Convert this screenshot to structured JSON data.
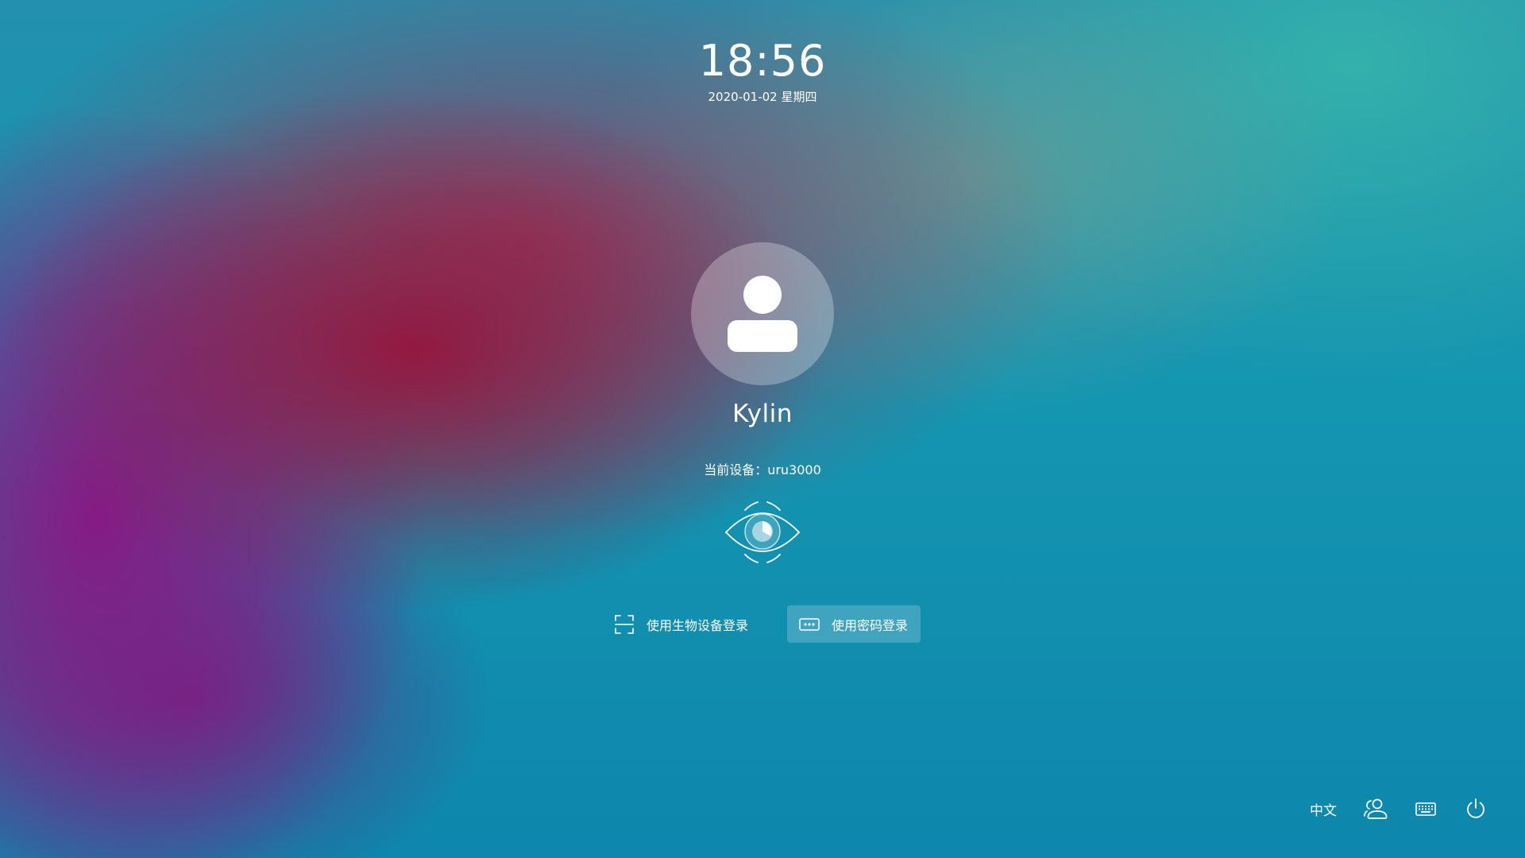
{
  "clock": {
    "time": "18:56",
    "date": "2020-01-02 星期四"
  },
  "user": {
    "avatar_icon": "user-avatar-icon",
    "name": "Kylin"
  },
  "device": {
    "text": "当前设备：uru3000",
    "biometric_icon": "eye-scan-icon"
  },
  "login_options": {
    "biometric_label": "使用生物设备登录",
    "biometric_icon": "scan-frame-icon",
    "password_label": "使用密码登录",
    "password_icon": "password-dots-icon"
  },
  "bottom_bar": {
    "language_label": "中文",
    "switch_user_icon": "switch-user-icon",
    "keyboard_icon": "keyboard-icon",
    "power_icon": "power-icon"
  }
}
